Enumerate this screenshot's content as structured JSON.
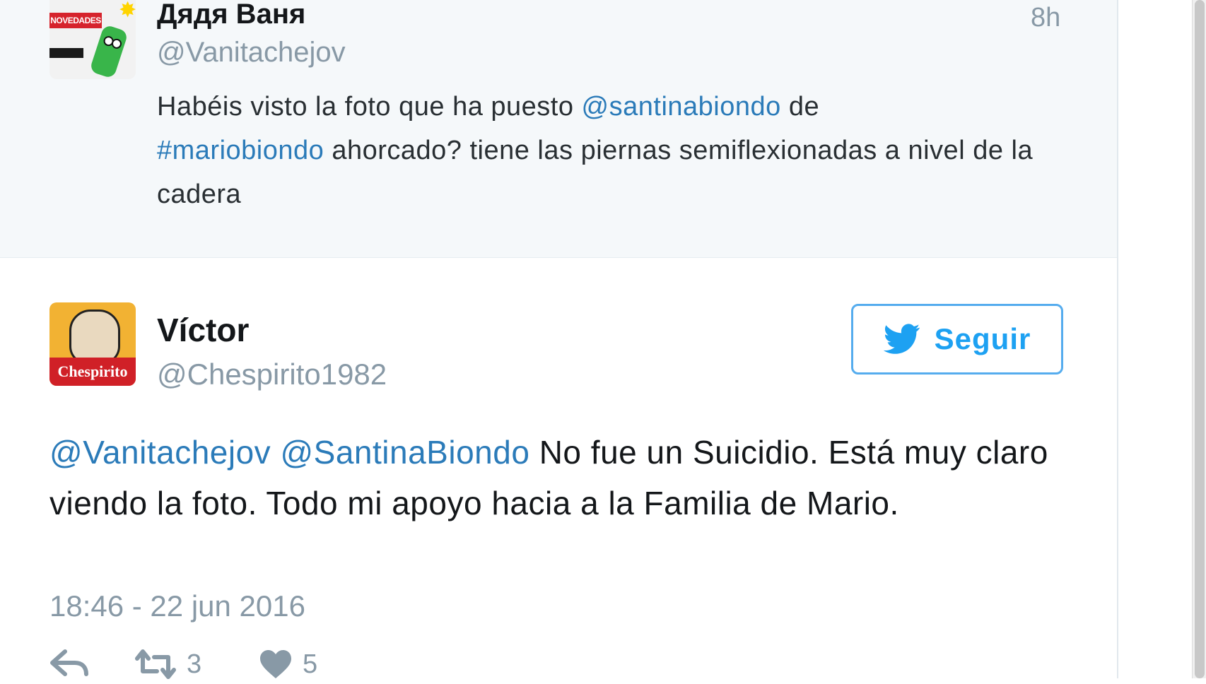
{
  "reply_tweet": {
    "user_name": "Дядя Ваня",
    "handle": "@Vanitachejov",
    "time": "8h",
    "avatar_text": "NOVEDADES",
    "text_parts": [
      "Habéis visto la foto que ha puesto ",
      "@santinabiondo",
      " de ",
      "#mariobiondo",
      " ahorcado? tiene las piernas semiflexionadas a nivel de la cadera"
    ]
  },
  "main_tweet": {
    "user_name": "Víctor",
    "handle": "@Chespirito1982",
    "avatar_text": "Chespirito",
    "follow_label": "Seguir",
    "text_parts": [
      "@Vanitachejov",
      " ",
      "@SantinaBiondo",
      " No fue un Suicidio. Está muy claro viendo la foto. Todo mi apoyo hacia a la Familia de Mario."
    ],
    "timestamp": "18:46 - 22 jun 2016",
    "retweet_count": "3",
    "like_count": "5"
  },
  "colors": {
    "link": "#2b7bb9",
    "follow": "#1da1f2",
    "muted": "#8899a6"
  }
}
